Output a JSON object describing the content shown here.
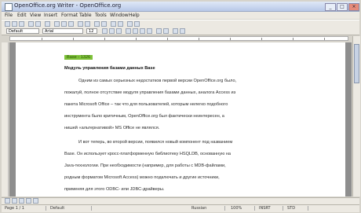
{
  "window": {
    "title": "OpenOffice.org Writer - OpenOffice.org",
    "min": "_",
    "max": "□",
    "close": "×"
  },
  "menu": [
    "File",
    "Edit",
    "View",
    "Insert",
    "Format",
    "Table",
    "Tools",
    "Window",
    "Help"
  ],
  "formatting": {
    "style": "Default",
    "font": "Arial",
    "size": "12"
  },
  "document": {
    "tag": "Base - 1326",
    "heading": "Модуль управления базами данных Base",
    "paragraphs": [
      "Одним из самых серьезных недостатков первой версии OpenOffice.org было,",
      "пожалуй, полное отсутствие модуля управления базами данных, аналога Access из",
      "пакета Microsoft Office – так что для пользователей, которым нелегко подобного",
      "инструмента было критичным, OpenOffice.org был фактически неинтересен, а",
      "нишей «альтернативой» MS Office не являлся.",
      "И вот теперь, во второй версии, появился новый компонент под названием",
      "Base. Он использует кросс-платформенную библиотеку HSQLDB, основанную на",
      "Java-технологии. При необходимости (например, для работы с MDB-файлами,",
      "родным форматом Microsoft Access) можно подключать и другие источники,",
      "применяя для этого ODBC- или JDBC-драйверы."
    ]
  },
  "status": [
    "Page 1 / 1",
    "Default",
    "Russian",
    "100%",
    "INSRT",
    "STD"
  ]
}
